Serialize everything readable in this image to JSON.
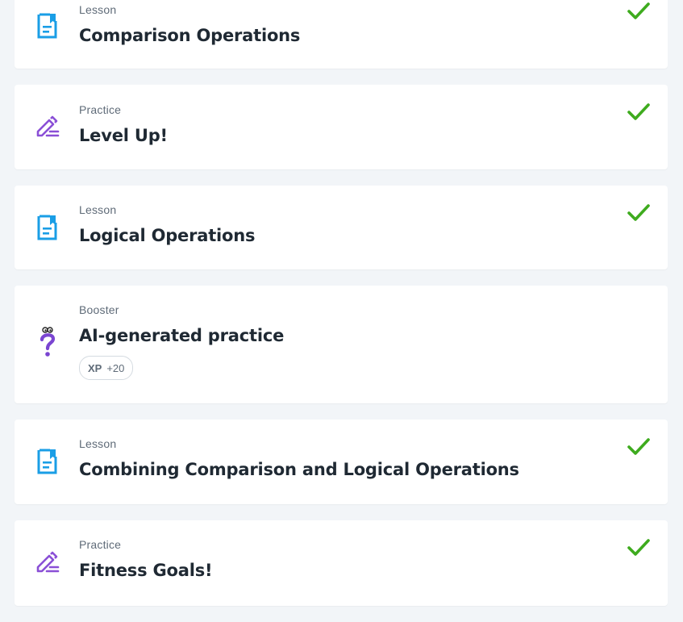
{
  "items": [
    {
      "type": "Lesson",
      "title": "Comparison Operations",
      "icon": "lesson-doc-icon",
      "completed": true
    },
    {
      "type": "Practice",
      "title": "Level Up!",
      "icon": "practice-pencil-icon",
      "completed": true
    },
    {
      "type": "Lesson",
      "title": "Logical Operations",
      "icon": "lesson-doc-icon",
      "completed": true
    },
    {
      "type": "Booster",
      "title": "AI-generated practice",
      "icon": "question-mark-icon",
      "completed": false,
      "xp_label": "XP",
      "xp_value": "+20"
    },
    {
      "type": "Lesson",
      "title": "Combining Comparison and Logical Operations",
      "icon": "lesson-doc-icon",
      "completed": true
    },
    {
      "type": "Practice",
      "title": "Fitness Goals!",
      "icon": "practice-pencil-icon",
      "completed": true
    }
  ],
  "colors": {
    "lesson_icon": "#1a9ee6",
    "practice_icon": "#8a4fd6",
    "booster_icon": "#7a45d1",
    "check": "#3eab1e"
  }
}
